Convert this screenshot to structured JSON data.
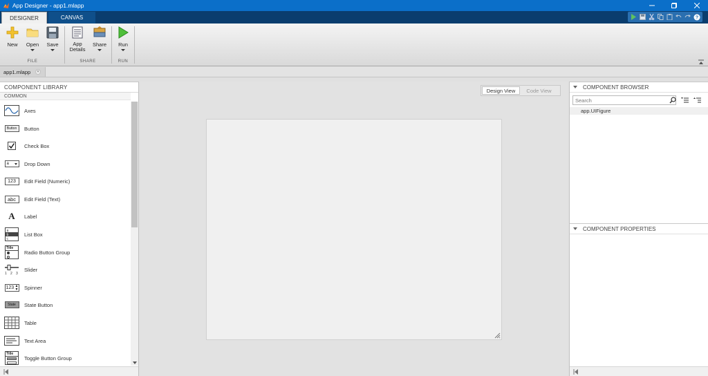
{
  "window": {
    "title": "App Designer - app1.mlapp",
    "controls": [
      "minimize-icon",
      "maximize-icon",
      "close-icon"
    ]
  },
  "tabs": [
    {
      "label": "DESIGNER",
      "active": true
    },
    {
      "label": "CANVAS",
      "active": false
    }
  ],
  "quick_access": [
    "run-icon",
    "save-icon",
    "cut-icon",
    "copy-icon",
    "paste-icon",
    "undo-icon",
    "redo-icon",
    "help-icon"
  ],
  "ribbon": {
    "buttons": [
      {
        "id": "new",
        "label": "New",
        "icon": "new-icon",
        "dropdown": false
      },
      {
        "id": "open",
        "label": "Open",
        "icon": "folder-icon",
        "dropdown": true
      },
      {
        "id": "save",
        "label": "Save",
        "icon": "save-icon",
        "dropdown": true
      },
      {
        "id": "app-details",
        "label": "App\nDetails",
        "icon": "app-details-icon",
        "dropdown": false
      },
      {
        "id": "share",
        "label": "Share",
        "icon": "share-icon",
        "dropdown": true
      },
      {
        "id": "run",
        "label": "Run",
        "icon": "run-icon",
        "dropdown": true
      }
    ],
    "groups": [
      "FILE",
      "SHARE",
      "RUN"
    ]
  },
  "document_tab": {
    "label": "app1.mlapp"
  },
  "component_library": {
    "title": "COMPONENT LIBRARY",
    "section": "COMMON",
    "items": [
      {
        "label": "Axes",
        "icon": "axes-icon"
      },
      {
        "label": "Button",
        "icon": "button-icon",
        "icon_text": "Button"
      },
      {
        "label": "Check Box",
        "icon": "checkbox-icon"
      },
      {
        "label": "Drop Down",
        "icon": "dropdown-icon",
        "icon_text": "a"
      },
      {
        "label": "Edit Field (Numeric)",
        "icon": "numeric-field-icon",
        "icon_text": "123"
      },
      {
        "label": "Edit Field (Text)",
        "icon": "text-field-icon",
        "icon_text": "abc"
      },
      {
        "label": "Label",
        "icon": "label-icon",
        "icon_text": "A"
      },
      {
        "label": "List Box",
        "icon": "listbox-icon"
      },
      {
        "label": "Radio Button Group",
        "icon": "radio-group-icon",
        "icon_text": "Title"
      },
      {
        "label": "Slider",
        "icon": "slider-icon"
      },
      {
        "label": "Spinner",
        "icon": "spinner-icon",
        "icon_text": "123"
      },
      {
        "label": "State Button",
        "icon": "state-button-icon",
        "icon_text": "State"
      },
      {
        "label": "Table",
        "icon": "table-icon"
      },
      {
        "label": "Text Area",
        "icon": "textarea-icon"
      },
      {
        "label": "Toggle Button Group",
        "icon": "toggle-group-icon",
        "icon_text": "Title"
      }
    ]
  },
  "view_toggle": {
    "design": "Design View",
    "code": "Code View",
    "active": "design"
  },
  "component_browser": {
    "title": "COMPONENT BROWSER",
    "search_placeholder": "Search",
    "tree": [
      "app.UIFigure"
    ]
  },
  "component_properties": {
    "title": "COMPONENT PROPERTIES"
  }
}
